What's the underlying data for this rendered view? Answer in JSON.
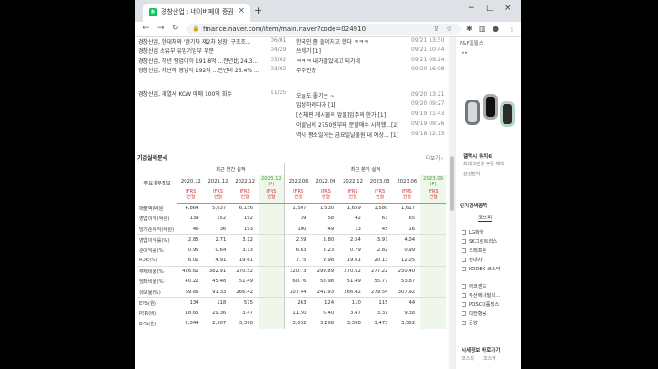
{
  "tab": {
    "title": "경창산업 : 네이버페이 증권"
  },
  "address": {
    "url": "finance.naver.com/item/main.naver?code=024910"
  },
  "news": [
    {
      "title": "경창산업, 현대차와 '경기차 제2차 성장' 구조조...",
      "date": "06/01"
    },
    {
      "title": "경창산업 소유부 유망기업부 부분",
      "date": "04/29"
    },
    {
      "title": "경창산업, 작년 영업이익 191.8억 ...전년比 24.3...",
      "date": "03/02"
    },
    {
      "title": "경창산업, 지난해 영업익 192억 ...전년비 25.4% ...",
      "date": "03/02"
    },
    {
      "title": "경창산업, 게열사 KCW 매매 100억 회수",
      "date": "11/25"
    }
  ],
  "discussion": [
    {
      "title": "한국인 좀 들이자고 했다 ㅋㅋㅋ",
      "date": "09/21 13:50"
    },
    {
      "title": "쓰레기 [1]",
      "date": "09/21 10:44"
    },
    {
      "title": "ㅋㅋㅋ 내가팔았데고 되가네",
      "date": "09/21 09:24"
    },
    {
      "title": "주주인증",
      "date": "09/20 16:08"
    },
    {
      "title": "오늘도 좋기는 ~",
      "date": "09/20 13:21"
    },
    {
      "title": "입성하려다가 [1]",
      "date": "09/20 09:27"
    },
    {
      "title": "[신체판 게시물의 앞물]입주의 한가 [1]",
      "date": "09/19 21:43"
    },
    {
      "title": "이럴님이 2750원부터 분할매수 시작했...[2]",
      "date": "09/19 09:26"
    },
    {
      "title": "역시 평소일어는 금요일날물원 내 예상... [1]",
      "date": "09/18 12:13"
    }
  ],
  "financials": {
    "section_title": "기업실적분석",
    "more_label": "더보기",
    "row_header": "주요재무정보",
    "annual_label": "최근 연간 실적",
    "quarter_label": "최근 분기 실적",
    "annual_years": [
      "2020.12",
      "2021.12",
      "2022.12",
      "2023.12"
    ],
    "quarter_years": [
      "2022.06",
      "2022.09",
      "2022.12",
      "2023.03",
      "2023.06",
      "2023.09"
    ],
    "estimate_tag": "(E)",
    "ifrs_label": "IFRS",
    "ifrs_sub": "연결",
    "rows": [
      {
        "label": "매출액(억원)",
        "values": [
          "4,864",
          "5,637",
          "6,156",
          "",
          "1,507",
          "1,530",
          "1,659",
          "1,580",
          "1,617",
          ""
        ]
      },
      {
        "label": "영업이익(억원)",
        "values": [
          "139",
          "152",
          "192",
          "",
          "39",
          "58",
          "42",
          "63",
          "65",
          ""
        ]
      },
      {
        "label": "당기순이익(억원)",
        "values": [
          "46",
          "36",
          "193",
          "",
          "100",
          "49",
          "13",
          "45",
          "16",
          ""
        ]
      },
      {
        "label": "영업이익률(%)",
        "values": [
          "2.85",
          "2.71",
          "3.12",
          "",
          "2.59",
          "3.80",
          "2.54",
          "3.97",
          "4.04",
          ""
        ]
      },
      {
        "label": "순이익률(%)",
        "values": [
          "0.95",
          "0.64",
          "3.13",
          "",
          "6.63",
          "3.23",
          "0.79",
          "2.82",
          "0.99",
          ""
        ]
      },
      {
        "label": "ROE(%)",
        "values": [
          "6.01",
          "4.91",
          "19.61",
          "",
          "7.75",
          "9.98",
          "19.61",
          "20.13",
          "12.05",
          ""
        ]
      },
      {
        "label": "부채비율(%)",
        "values": [
          "426.61",
          "382.91",
          "270.52",
          "",
          "320.73",
          "299.89",
          "270.52",
          "277.22",
          "250.40",
          ""
        ]
      },
      {
        "label": "당좌비율(%)",
        "values": [
          "40.22",
          "45.48",
          "51.49",
          "",
          "60.76",
          "58.98",
          "51.49",
          "55.77",
          "53.87",
          ""
        ]
      },
      {
        "label": "유보율(%)",
        "values": [
          "69.86",
          "91.33",
          "266.42",
          "",
          "207.44",
          "241.93",
          "266.42",
          "279.54",
          "307.92",
          ""
        ]
      },
      {
        "label": "EPS(원)",
        "values": [
          "134",
          "118",
          "575",
          "",
          "263",
          "124",
          "110",
          "115",
          "44",
          ""
        ]
      },
      {
        "label": "PER(배)",
        "values": [
          "18.65",
          "29.36",
          "3.47",
          "",
          "11.50",
          "6.40",
          "3.47",
          "3.31",
          "9.38",
          ""
        ]
      },
      {
        "label": "BPS(원)",
        "values": [
          "2,344",
          "2,507",
          "3,398",
          "",
          "3,032",
          "3,208",
          "3,398",
          "3,473",
          "3,552",
          ""
        ]
      }
    ]
  },
  "side": {
    "ad_top": "F&F홈필스",
    "ad_product": "갤럭시 워치6",
    "ad_desc": "최대 3만원 쿠폰 혜택",
    "ad_brand": "삼성전자",
    "popular_title": "인기검색종목",
    "popular_tab": "코스피",
    "popular": [
      "LG화학",
      "SK그린트리스",
      "크래프톤",
      "현대차",
      "KODEX 코스닥"
    ],
    "popular2": [
      "에코센드",
      "두산에너빌리...",
      "POSCO홀딩스",
      "대한항공",
      "금양"
    ],
    "bottom_title": "시세정보 바로가기",
    "bottom_tabs": [
      "코스피",
      "코스닥"
    ]
  },
  "colors": {
    "accent": "#03c75a",
    "estimate_bg": "#eef7ea"
  }
}
